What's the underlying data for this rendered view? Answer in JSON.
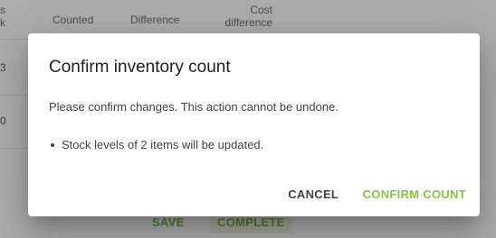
{
  "table": {
    "columns": {
      "edge_top": "s",
      "edge_bottom": "k",
      "counted": "Counted",
      "difference": "Difference",
      "cost_difference_line1": "Cost",
      "cost_difference_line2": "difference"
    },
    "rows": [
      {
        "edge_value": "3"
      },
      {
        "edge_value": "0"
      }
    ],
    "actions": {
      "save": "SAVE",
      "complete": "COMPLETE"
    }
  },
  "dialog": {
    "title": "Confirm inventory count",
    "message": "Please confirm changes. This action cannot be undone.",
    "details": [
      "Stock levels of 2 items will be updated."
    ],
    "buttons": {
      "cancel": "CANCEL",
      "confirm": "CONFIRM COUNT"
    }
  },
  "colors": {
    "accent": "#8bc34a",
    "text_primary": "#212121",
    "overlay": "rgba(0,0,0,0.32)"
  }
}
